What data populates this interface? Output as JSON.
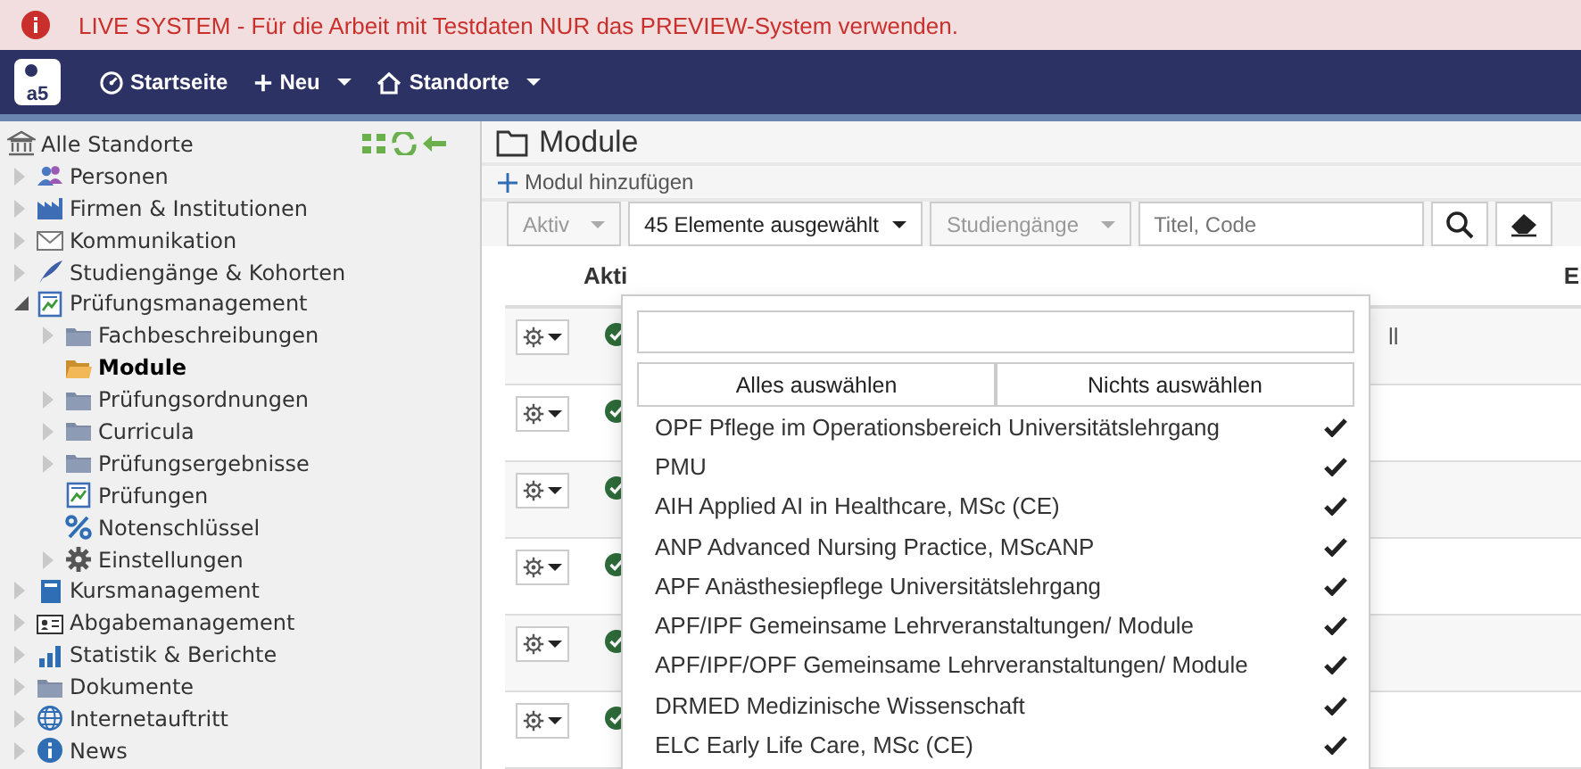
{
  "banner": {
    "text": "LIVE SYSTEM - Für die Arbeit mit Testdaten NUR das PREVIEW-System verwenden."
  },
  "navbar": {
    "logo": "a5",
    "items": [
      {
        "label": "Startseite",
        "dropdown": false
      },
      {
        "label": "Neu",
        "dropdown": true
      },
      {
        "label": "Standorte",
        "dropdown": true
      }
    ]
  },
  "sidebar": {
    "root": "Alle Standorte",
    "items": [
      {
        "label": "Personen",
        "expanded": false,
        "selected": false
      },
      {
        "label": "Firmen & Institutionen",
        "expanded": false,
        "selected": false
      },
      {
        "label": "Kommunikation",
        "expanded": false,
        "selected": false
      },
      {
        "label": "Studiengänge & Kohorten",
        "expanded": false,
        "selected": false
      },
      {
        "label": "Prüfungsmanagement",
        "expanded": true,
        "selected": false,
        "children": [
          {
            "label": "Fachbeschreibungen",
            "expanded": false,
            "selected": false
          },
          {
            "label": "Module",
            "selected": true
          },
          {
            "label": "Prüfungsordnungen",
            "expanded": false,
            "selected": false
          },
          {
            "label": "Curricula",
            "expanded": false,
            "selected": false
          },
          {
            "label": "Prüfungsergebnisse",
            "expanded": false,
            "selected": false
          },
          {
            "label": "Prüfungen",
            "selected": false
          },
          {
            "label": "Notenschlüssel",
            "selected": false
          },
          {
            "label": "Einstellungen",
            "expanded": false,
            "selected": false
          }
        ]
      },
      {
        "label": "Kursmanagement",
        "expanded": false,
        "selected": false
      },
      {
        "label": "Abgabemanagement",
        "expanded": false,
        "selected": false
      },
      {
        "label": "Statistik & Berichte",
        "expanded": false,
        "selected": false
      },
      {
        "label": "Dokumente",
        "expanded": false,
        "selected": false
      },
      {
        "label": "Internetauftritt",
        "expanded": false,
        "selected": false
      },
      {
        "label": "News",
        "expanded": false,
        "selected": false
      }
    ]
  },
  "page": {
    "title": "Module",
    "add_button": "Modul hinzufügen"
  },
  "filters": {
    "status": "Aktiv",
    "selection": "45 Elemente ausgewählt",
    "programs": "Studiengänge",
    "search_placeholder": "Titel, Code"
  },
  "dropdown": {
    "select_all": "Alles auswählen",
    "select_none": "Nichts auswählen",
    "options": [
      {
        "label": "OPF Pflege im Operationsbereich Universitätslehrgang",
        "selected": true
      },
      {
        "label": "PMU",
        "selected": true
      },
      {
        "label": "AIH Applied AI in Healthcare, MSc (CE)",
        "selected": true
      },
      {
        "label": "ANP Advanced Nursing Practice, MScANP",
        "selected": true
      },
      {
        "label": "APF Anästhesiepflege Universitätslehrgang",
        "selected": true
      },
      {
        "label": "APF/IPF Gemeinsame Lehrveranstaltungen/ Module",
        "selected": true
      },
      {
        "label": "APF/IPF/OPF Gemeinsame Lehrveranstaltungen/ Module",
        "selected": true
      },
      {
        "label": "DRMED Medizinische Wissenschaft",
        "selected": true
      },
      {
        "label": "ELC Early Life Care, MSc (CE)",
        "selected": true
      }
    ]
  },
  "table": {
    "columns": [
      "Akti",
      "E"
    ],
    "rows": [
      {
        "active": true,
        "column_3": "ll"
      },
      {
        "active": true
      },
      {
        "active": true
      },
      {
        "active": true
      },
      {
        "active": true
      },
      {
        "active": true
      }
    ]
  }
}
